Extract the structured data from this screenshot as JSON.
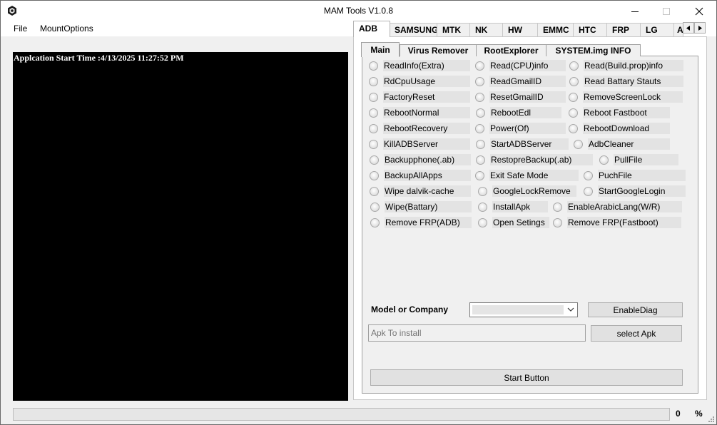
{
  "window": {
    "title": "MAM Tools V1.0.8"
  },
  "menu": {
    "file": "File",
    "mount_options": "MountOptions"
  },
  "console": {
    "text": "Applcation Start Time :4/13/2025 11:27:52 PM"
  },
  "top_tabs": [
    "ADB",
    "SAMSUNG",
    "MTK",
    "NK",
    "HW",
    "EMMC",
    "HTC",
    "FRP",
    "LG",
    "A"
  ],
  "top_tabs_active": "ADB",
  "inner_tabs": [
    "Main",
    "Virus Remover",
    "RootExplorer",
    "SYSTEM.img INFO"
  ],
  "inner_tabs_active": "Main",
  "options": {
    "col1": [
      "ReadInfo(Extra)",
      "RdCpuUsage",
      "FactoryReset",
      "RebootNormal",
      "RebootRecovery",
      "KillADBServer",
      "Backupphone(.ab)",
      "BackupAllApps",
      "Wipe dalvik-cache",
      "Wipe(Battary)",
      "Remove FRP(ADB)"
    ],
    "col2": [
      "Read(CPU)info",
      "ReadGmailID",
      "ResetGmailID",
      "RebootEdl",
      "Power(Of)",
      "StartADBServer",
      "RestopreBackup(.ab)",
      "Exit Safe Mode",
      "GoogleLockRemove",
      "InstallApk",
      "Open Setings"
    ],
    "col3": [
      "Read(Build.prop)info",
      "Read Battary Stauts",
      "RemoveScreenLock",
      "Reboot Fastboot",
      "RebootDownload",
      "AdbCleaner",
      "PullFile",
      "PuchFile",
      "StartGoogleLogin",
      "EnableArabicLang(W/R)",
      "Remove FRP(Fastboot)"
    ]
  },
  "controls": {
    "model_label": "Model or Company",
    "model_value": "",
    "enable_diag": "EnableDiag",
    "apk_placeholder": "Apk To install",
    "select_apk": "select Apk",
    "start_button": "Start Button"
  },
  "status": {
    "progress_value": "0",
    "progress_unit": "%",
    "progress_fraction": 0
  },
  "colors": {
    "console_bg": "#000000",
    "console_text": "#ffffff",
    "progress_fill": "#06b025"
  }
}
